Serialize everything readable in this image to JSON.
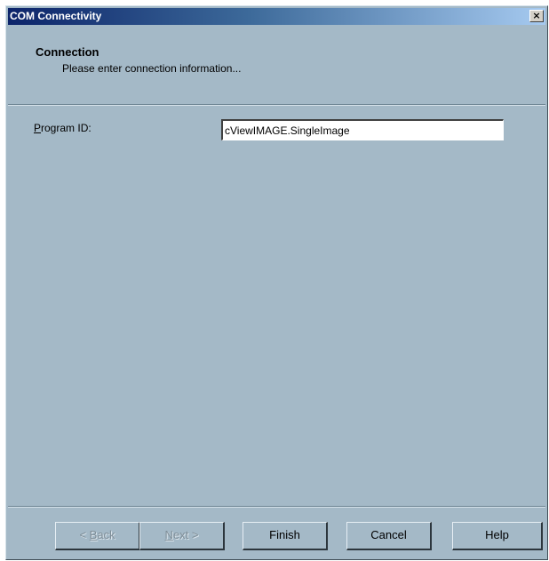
{
  "window": {
    "title": "COM Connectivity",
    "close_glyph": "×",
    "close_icon": "close-icon"
  },
  "header": {
    "title": "Connection",
    "subtitle": "Please enter connection information..."
  },
  "form": {
    "program_id": {
      "label_mnemonic": "P",
      "label_rest": "rogram ID:",
      "value": "cViewIMAGE.SingleImage"
    }
  },
  "buttons": {
    "back": {
      "prefix": "< ",
      "mnemonic": "B",
      "rest": "ack",
      "enabled": false
    },
    "next": {
      "mnemonic": "N",
      "rest": "ext >",
      "enabled": false
    },
    "finish": {
      "label": "Finish"
    },
    "cancel": {
      "label": "Cancel"
    },
    "help": {
      "label": "Help"
    }
  },
  "colors": {
    "dialog_background": "#a4b9c7",
    "titlebar_start": "#0c246a",
    "titlebar_end": "#a6caf0"
  }
}
